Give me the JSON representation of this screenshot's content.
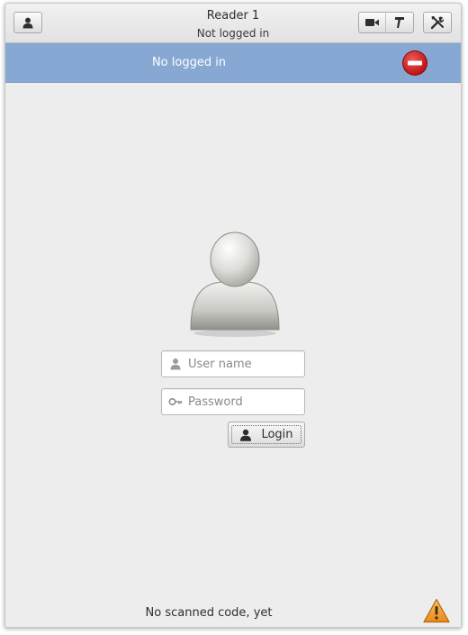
{
  "header": {
    "title": "Reader 1",
    "subtitle": "Not logged in",
    "buttons": {
      "user": "user-icon",
      "camera": "video-camera-icon",
      "scanner": "barcode-scanner-icon",
      "tools": "tools-icon"
    }
  },
  "status_bar": {
    "text": "No logged in",
    "icon": "stop-icon",
    "background": "#86a8d3"
  },
  "login_form": {
    "avatar": "avatar-icon",
    "username_placeholder": "User name",
    "password_placeholder": "Password",
    "login_label": "Login"
  },
  "footer": {
    "text": "No scanned code, yet",
    "icon": "warning-icon"
  },
  "colors": {
    "window_bg": "#ededed",
    "status_bg": "#86a8d3",
    "stop_red": "#d32020",
    "warning_orange": "#f2a33a"
  }
}
